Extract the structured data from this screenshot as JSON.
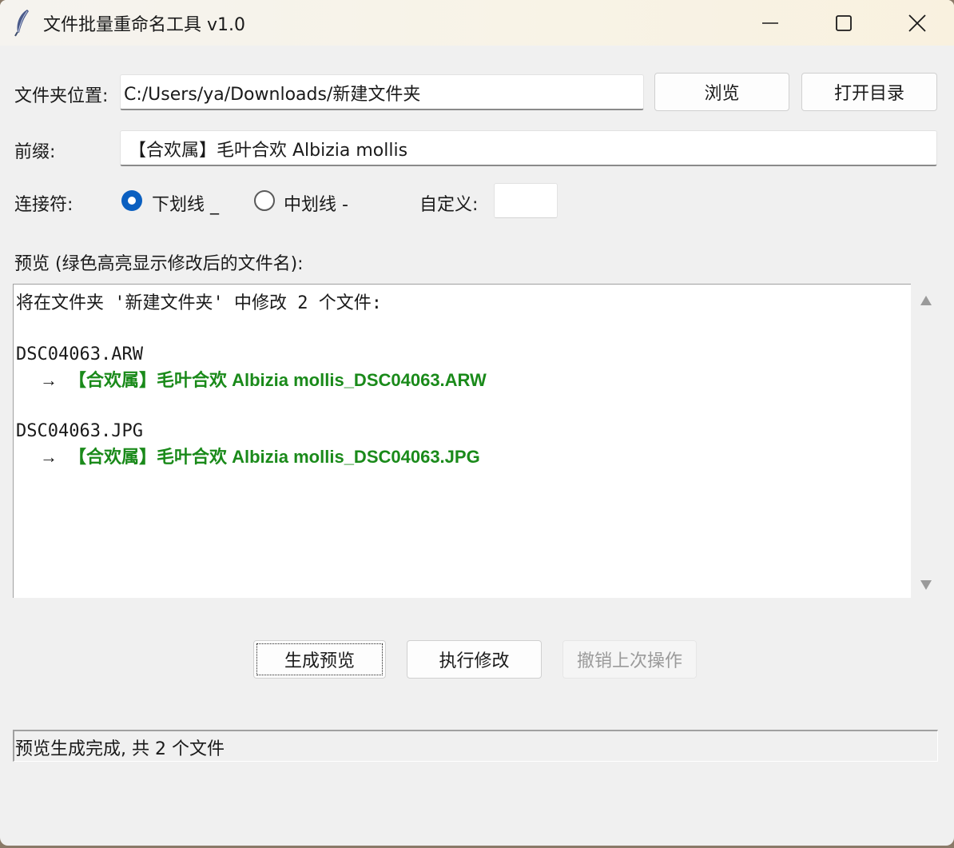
{
  "window": {
    "title": "文件批量重命名工具 v1.0"
  },
  "folder": {
    "label": "文件夹位置:",
    "value": "C:/Users/ya/Downloads/新建文件夹",
    "browse_label": "浏览",
    "open_label": "打开目录"
  },
  "prefix": {
    "label": "前缀:",
    "value": "【合欢属】毛叶合欢 Albizia mollis"
  },
  "connector": {
    "label": "连接符:",
    "options": [
      {
        "label": "下划线 _",
        "selected": true
      },
      {
        "label": "中划线 -",
        "selected": false
      }
    ],
    "custom_label": "自定义:",
    "custom_value": ""
  },
  "preview": {
    "label": "预览 (绿色高亮显示修改后的文件名):",
    "header": "将在文件夹 '新建文件夹' 中修改 2 个文件:",
    "arrow": "→",
    "files": [
      {
        "old": "DSC04063.ARW",
        "new": "【合欢属】毛叶合欢 Albizia mollis_DSC04063.ARW"
      },
      {
        "old": "DSC04063.JPG",
        "new": "【合欢属】毛叶合欢 Albizia mollis_DSC04063.JPG"
      }
    ],
    "highlight_color": "#1a8a1a"
  },
  "actions": {
    "preview_label": "生成预览",
    "execute_label": "执行修改",
    "undo_label": "撤销上次操作"
  },
  "status": {
    "text": "预览生成完成, 共 2 个文件"
  },
  "icons": {
    "app": "feather-icon",
    "minimize": "minimize-icon",
    "maximize": "maximize-icon",
    "close": "close-icon"
  }
}
